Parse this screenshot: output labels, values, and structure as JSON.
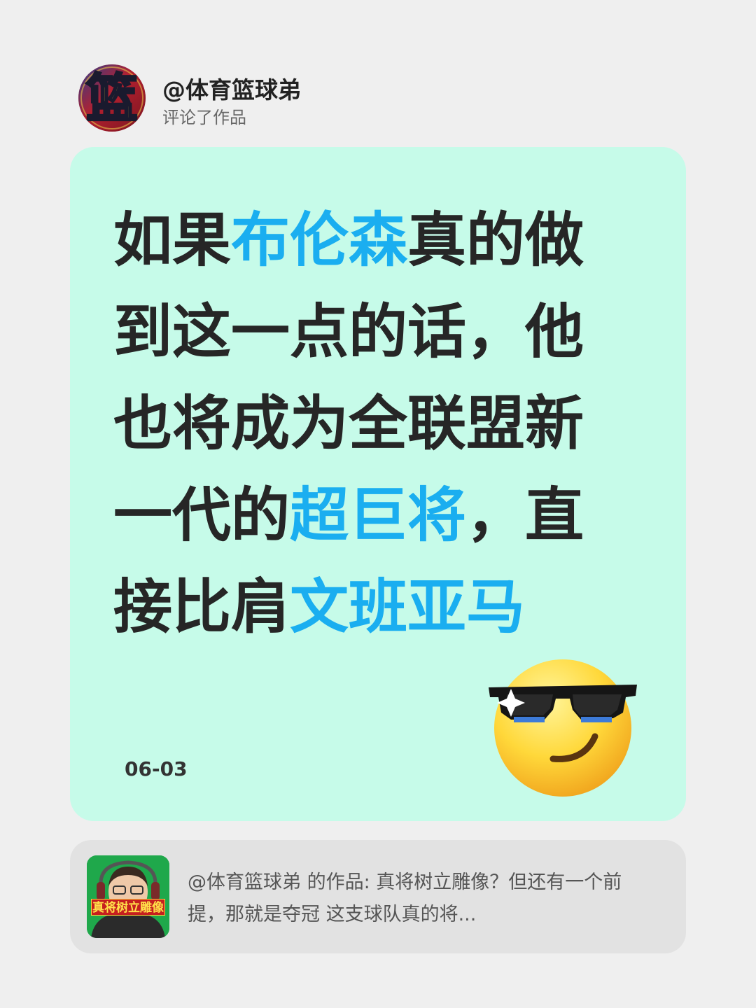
{
  "header": {
    "avatar_text": "篮",
    "username": "@体育篮球弟",
    "action": "评论了作品"
  },
  "comment": {
    "segments": [
      {
        "text": "如果",
        "highlight": false
      },
      {
        "text": "布伦森",
        "highlight": true
      },
      {
        "text": "真的做到这一点的话，他也将成为全联盟新一代的",
        "highlight": false
      },
      {
        "text": "超巨将",
        "highlight": true
      },
      {
        "text": "，直接比肩",
        "highlight": false
      },
      {
        "text": "文班亚马",
        "highlight": true
      }
    ],
    "highlight_color": "#1aaef0",
    "date": "06-03",
    "emoji": "smiling-face-with-sunglasses"
  },
  "quoted_work": {
    "thumbnail_caption": "真将树立雕像",
    "text": "@体育篮球弟  的作品: 真将树立雕像？但还有一个前提，那就是夺冠 这支球队真的将..."
  },
  "colors": {
    "page_background": "#efefef",
    "card_background": "#c6fbe9",
    "quote_background": "#e2e2e2"
  }
}
